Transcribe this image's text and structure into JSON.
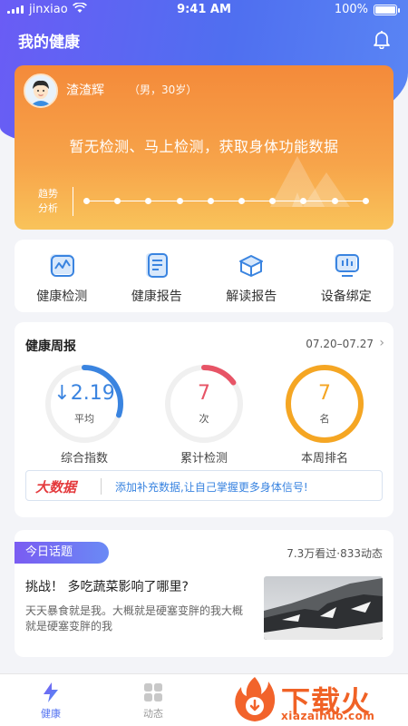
{
  "status_bar": {
    "carrier": "jinxiao",
    "time": "9:41 AM",
    "battery": "100%"
  },
  "header": {
    "title": "我的健康"
  },
  "health_card": {
    "user_name": "渣渣辉",
    "user_info": "（男，30岁）",
    "message": "暂无检测、马上检测，获取身体功能数据",
    "trend_label_line1": "趋势",
    "trend_label_line2": "分析"
  },
  "features": [
    {
      "label": "健康检测",
      "icon": "pulse-chart-icon"
    },
    {
      "label": "健康报告",
      "icon": "report-list-icon"
    },
    {
      "label": "解读报告",
      "icon": "open-box-icon"
    },
    {
      "label": "设备绑定",
      "icon": "monitor-device-icon"
    }
  ],
  "weekly": {
    "title": "健康周报",
    "date_range": "07.20–07.27",
    "gauges": [
      {
        "value": "↓2.19",
        "sub": "平均",
        "label": "综合指数",
        "color": "#3a84e0",
        "fill": 0.3
      },
      {
        "value": "7",
        "sub": "次",
        "label": "累计检测",
        "color": "#e75466",
        "fill": 0.15
      },
      {
        "value": "7",
        "sub": "名",
        "label": "本周排名",
        "color": "#f5a623",
        "fill": 1.0
      }
    ],
    "bigdata_logo": "大数据",
    "bigdata_text": "添加补充数据,让自己掌握更多身体信号!"
  },
  "topic": {
    "badge": "今日话题",
    "stats": "7.3万看过·833动态",
    "title": "挑战！ 多吃蔬菜影响了哪里?",
    "body": "天天暴食就是我。大概就是硬塞变胖的我大概就是硬塞变胖的我"
  },
  "tabs": [
    {
      "label": "健康",
      "icon": "lightning-icon",
      "active": true
    },
    {
      "label": "动态",
      "icon": "grid-icon",
      "active": false
    }
  ],
  "watermark": {
    "text": "下载火",
    "url": "xiazaihuo.com"
  },
  "colors": {
    "primary": "#4f6ff0",
    "accent_orange": "#f48a3a",
    "link_blue": "#3a84e0"
  }
}
